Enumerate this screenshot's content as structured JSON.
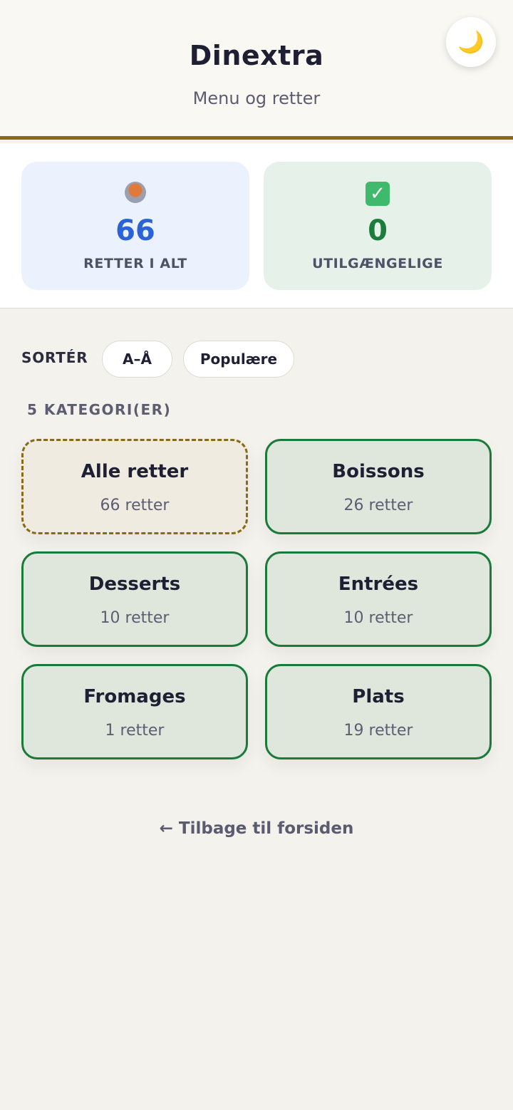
{
  "header": {
    "title": "Dinextra",
    "subtitle": "Menu og retter",
    "theme_icon": "moon-icon",
    "theme_glyph": "🌙"
  },
  "stats": {
    "total": {
      "icon": "cooking-pot-icon",
      "value": "66",
      "label": "RETTER I ALT"
    },
    "unavailable": {
      "icon": "check-mark-icon",
      "glyph": "✓",
      "value": "0",
      "label": "UTILGÆNGELIGE"
    }
  },
  "sort": {
    "label": "SORTÉR",
    "options": [
      "A–Å",
      "Populære"
    ]
  },
  "categories": {
    "count_label": "5 KATEGORI(ER)",
    "items": [
      {
        "name": "Alle retter",
        "sub": "66 retter"
      },
      {
        "name": "Boissons",
        "sub": "26 retter"
      },
      {
        "name": "Desserts",
        "sub": "10 retter"
      },
      {
        "name": "Entrées",
        "sub": "10 retter"
      },
      {
        "name": "Fromages",
        "sub": "1 retter"
      },
      {
        "name": "Plats",
        "sub": "19 retter"
      }
    ]
  },
  "footer": {
    "back_link": "← Tilbage til forsiden"
  },
  "colors": {
    "accent_gold": "#8a6a18",
    "accent_green": "#1a7a3a",
    "accent_blue": "#2a63d6"
  }
}
